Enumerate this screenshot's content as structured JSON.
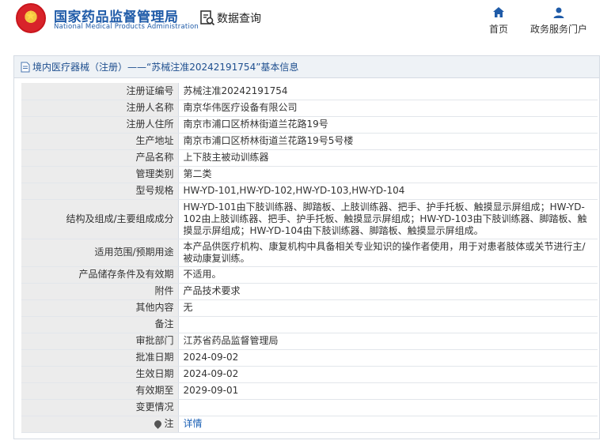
{
  "header": {
    "brand_cn": "国家药品监督管理局",
    "brand_en": "National Medical Products Administration",
    "query_label": "数据查询",
    "nav": {
      "home": "首页",
      "portal": "政务服务门户"
    }
  },
  "panel": {
    "title": "境内医疗器械（注册）——“苏械注准20242191754”基本信息"
  },
  "rows": [
    {
      "k": "注册证编号",
      "v": "苏械注准20242191754"
    },
    {
      "k": "注册人名称",
      "v": "南京华伟医疗设备有限公司"
    },
    {
      "k": "注册人住所",
      "v": "南京市浦口区桥林街道兰花路19号"
    },
    {
      "k": "生产地址",
      "v": "南京市浦口区桥林街道兰花路19号5号楼"
    },
    {
      "k": "产品名称",
      "v": "上下肢主被动训练器"
    },
    {
      "k": "管理类别",
      "v": "第二类"
    },
    {
      "k": "型号规格",
      "v": "HW-YD-101,HW-YD-102,HW-YD-103,HW-YD-104"
    },
    {
      "k": "结构及组成/主要组成成分",
      "v": "HW-YD-101由下肢训练器、脚踏板、上肢训练器、把手、护手托板、触摸显示屏组成；HW-YD-102由上肢训练器、把手、护手托板、触摸显示屏组成；HW-YD-103由下肢训练器、脚踏板、触摸显示屏组成；HW-YD-104由下肢训练器、脚踏板、触摸显示屏组成。"
    },
    {
      "k": "适用范围/预期用途",
      "v": "本产品供医疗机构、康复机构中具备相关专业知识的操作者使用，用于对患者肢体或关节进行主/被动康复训练。"
    },
    {
      "k": "产品储存条件及有效期",
      "v": "不适用。"
    },
    {
      "k": "附件",
      "v": "产品技术要求"
    },
    {
      "k": "其他内容",
      "v": "无"
    },
    {
      "k": "备注",
      "v": ""
    },
    {
      "k": "审批部门",
      "v": "江苏省药品监督管理局"
    },
    {
      "k": "批准日期",
      "v": "2024-09-02"
    },
    {
      "k": "生效日期",
      "v": "2024-09-02"
    },
    {
      "k": "有效期至",
      "v": "2029-09-01"
    },
    {
      "k": "变更情况",
      "v": ""
    },
    {
      "k": "注",
      "v": "详情"
    }
  ],
  "colors": {
    "brand": "#1f5ba8",
    "link": "#1a5fb4",
    "label_bg": "#ececec"
  },
  "icons": [
    "emblem-logo",
    "document-search-icon",
    "home-icon",
    "user-icon",
    "document-icon",
    "map-pin-icon"
  ]
}
